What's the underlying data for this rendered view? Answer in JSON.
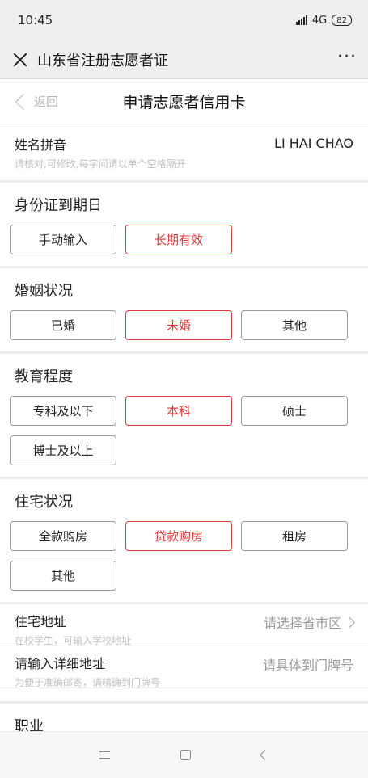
{
  "status_bar": {
    "time": "10:45",
    "network": "4G",
    "network_sub": "2",
    "battery": "82"
  },
  "app_bar": {
    "title": "山东省注册志愿者证",
    "more": "···"
  },
  "nav": {
    "back_label": "返回",
    "title": "申请志愿者信用卡"
  },
  "name_pinyin": {
    "label": "姓名拼音",
    "hint": "请核对,可修改,每字间请以单个空格隔开",
    "value": "LI HAI CHAO"
  },
  "sections": {
    "id_expiry": {
      "title": "身份证到期日",
      "options": [
        "手动输入",
        "长期有效"
      ],
      "selected": "长期有效"
    },
    "marital": {
      "title": "婚姻状况",
      "options": [
        "已婚",
        "未婚",
        "其他"
      ],
      "selected": "未婚"
    },
    "education": {
      "title": "教育程度",
      "options": [
        "专科及以下",
        "本科",
        "硕士",
        "博士及以上"
      ],
      "selected": "本科"
    },
    "housing": {
      "title": "住宅状况",
      "options": [
        "全款购房",
        "贷款购房",
        "租房",
        "其他"
      ],
      "selected": "贷款购房"
    }
  },
  "address": {
    "label": "住宅地址",
    "hint": "在校学生，可输入学校地址",
    "placeholder": "请选择省市区"
  },
  "detail_address": {
    "label": "请输入详细地址",
    "hint": "为便于准确邮寄，请精确到门牌号",
    "placeholder": "请具体到门牌号"
  },
  "job": {
    "label": "职业"
  },
  "colors": {
    "accent": "#e03a3a",
    "hint": "#c2c2c2",
    "border": "#9a9a9a"
  }
}
